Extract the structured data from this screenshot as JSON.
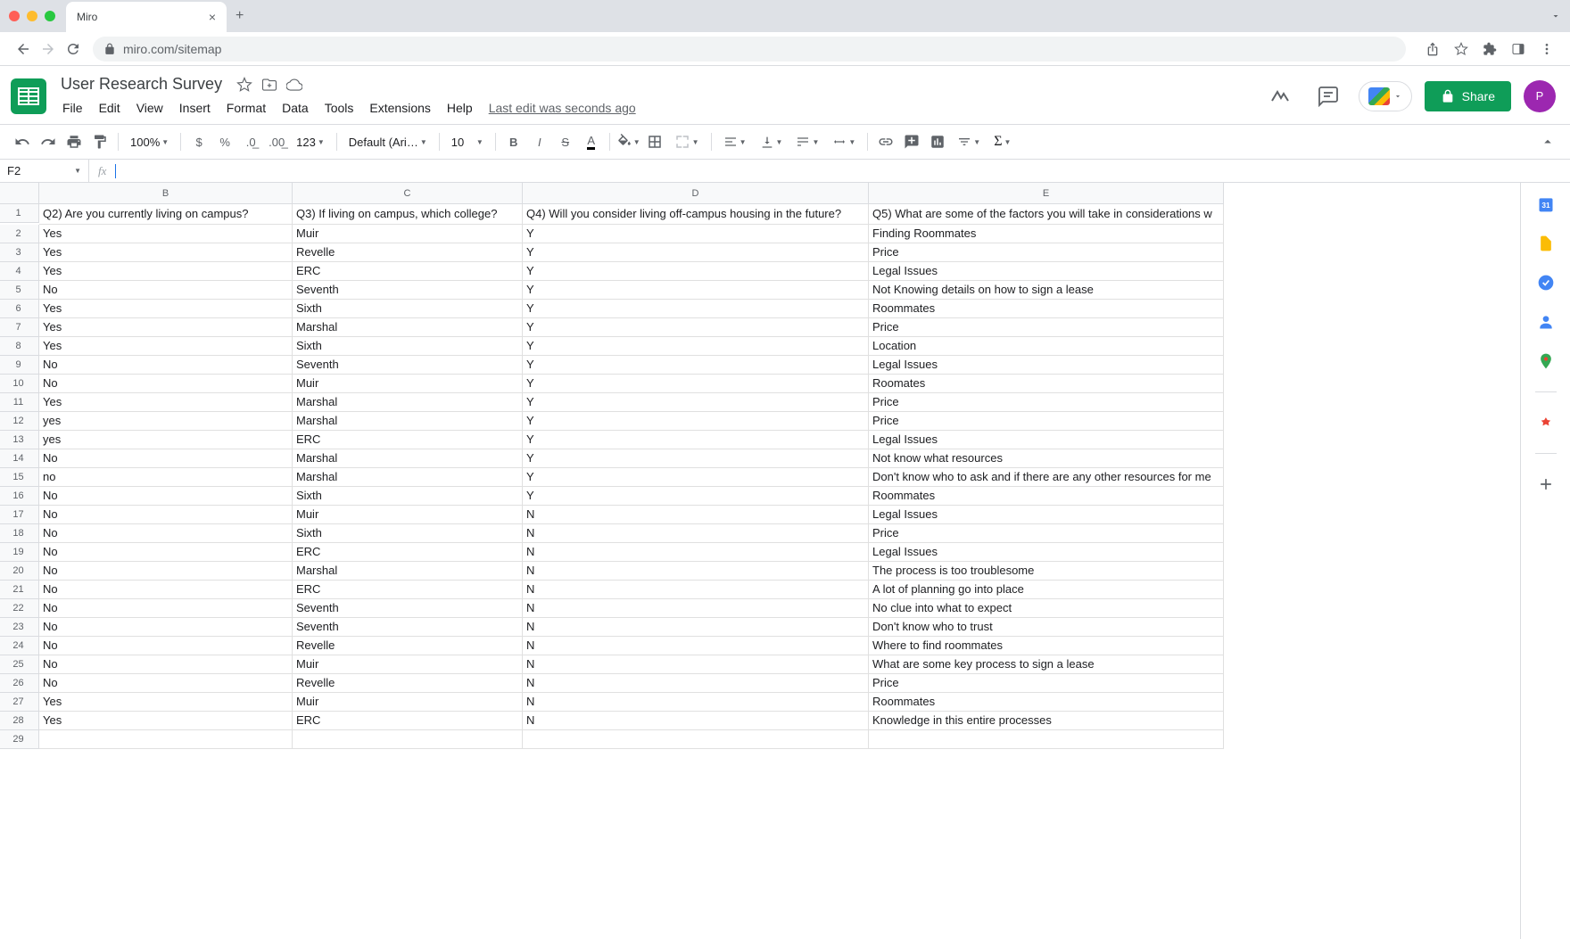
{
  "browser": {
    "tab_title": "Miro",
    "url": "miro.com/sitemap"
  },
  "doc": {
    "title": "User Research Survey",
    "last_edit": "Last edit was seconds ago",
    "avatar_initial": "P"
  },
  "menus": [
    "File",
    "Edit",
    "View",
    "Insert",
    "Format",
    "Data",
    "Tools",
    "Extensions",
    "Help"
  ],
  "toolbar": {
    "zoom": "100%",
    "font": "Default (Ari…",
    "font_size": "10",
    "more_formats": "123"
  },
  "share_label": "Share",
  "name_box": "F2",
  "columns": [
    "B",
    "C",
    "D",
    "E"
  ],
  "headers": [
    "Q2) Are you currently living on campus?",
    "Q3) If living on campus, which college?",
    "Q4) Will you consider living off-campus housing in the future?",
    "Q5) What are some of the factors you will take in considerations w"
  ],
  "rows": [
    [
      "Yes",
      "Muir",
      "Y",
      "Finding Roommates"
    ],
    [
      "Yes",
      "Revelle",
      "Y",
      "Price"
    ],
    [
      "Yes",
      "ERC",
      "Y",
      "Legal Issues"
    ],
    [
      "No",
      "Seventh",
      "Y",
      "Not Knowing details on how to sign a lease"
    ],
    [
      "Yes",
      "Sixth",
      "Y",
      "Roommates"
    ],
    [
      "Yes",
      "Marshal",
      "Y",
      "Price"
    ],
    [
      "Yes",
      "Sixth",
      "Y",
      "Location"
    ],
    [
      "No",
      "Seventh",
      "Y",
      "Legal Issues"
    ],
    [
      "No",
      "Muir",
      "Y",
      "Roomates"
    ],
    [
      "Yes",
      "Marshal",
      "Y",
      "Price"
    ],
    [
      "yes",
      "Marshal",
      "Y",
      "Price"
    ],
    [
      "yes",
      "ERC",
      "Y",
      "Legal Issues"
    ],
    [
      "No",
      "Marshal",
      "Y",
      "Not know what resources"
    ],
    [
      "no",
      "Marshal",
      "Y",
      "Don't know who to ask and if there are any other resources for me"
    ],
    [
      "No",
      "Sixth",
      "Y",
      "Roommates"
    ],
    [
      "No",
      "Muir",
      "N",
      "Legal Issues"
    ],
    [
      "No",
      "Sixth",
      "N",
      "Price"
    ],
    [
      "No",
      "ERC",
      "N",
      "Legal Issues"
    ],
    [
      "No",
      "Marshal",
      "N",
      "The process is too troublesome"
    ],
    [
      "No",
      "ERC",
      "N",
      "A lot of planning go into place"
    ],
    [
      "No",
      "Seventh",
      "N",
      "No clue into what to expect"
    ],
    [
      "No",
      "Seventh",
      "N",
      "Don't know who to trust"
    ],
    [
      "No",
      "Revelle",
      "N",
      "Where to find roommates"
    ],
    [
      "No",
      "Muir",
      "N",
      "What are some key process to sign a lease"
    ],
    [
      "No",
      "Revelle",
      "N",
      "Price"
    ],
    [
      "Yes",
      "Muir",
      "N",
      "Roommates"
    ],
    [
      "Yes",
      "ERC",
      "N",
      "Knowledge in this entire processes"
    ]
  ],
  "row_count": 29
}
